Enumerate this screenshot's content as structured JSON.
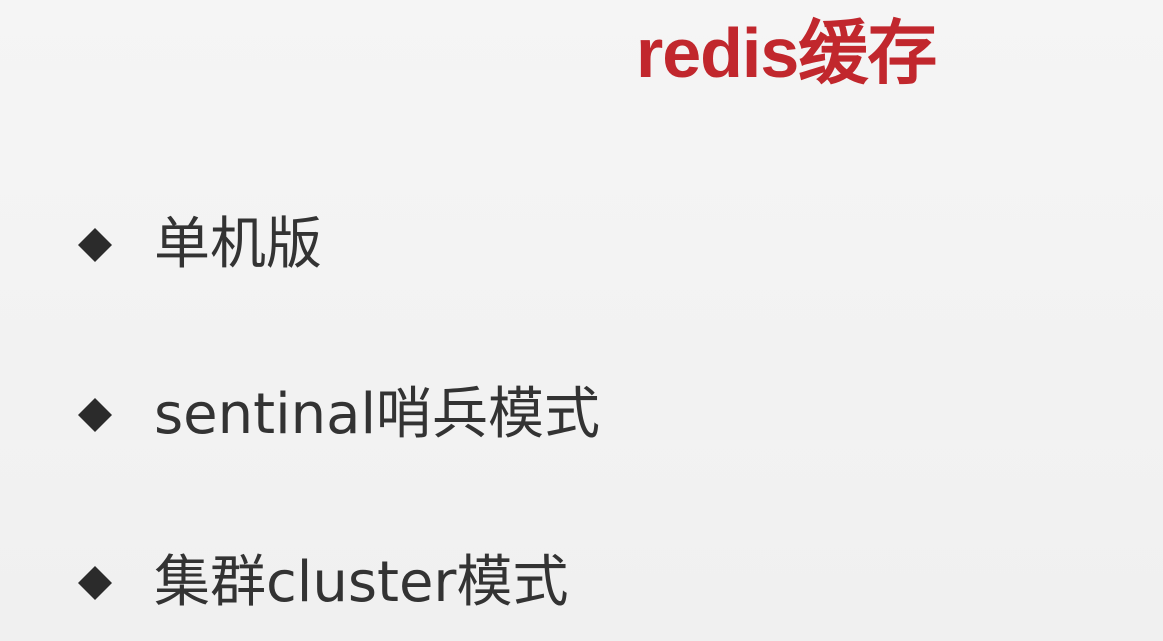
{
  "slide": {
    "title": "redis缓存",
    "title_color": "#c1272d",
    "bullets": [
      {
        "icon": "diamond-bullet-icon",
        "text": "单机版"
      },
      {
        "icon": "diamond-bullet-icon",
        "text": "sentinal哨兵模式"
      },
      {
        "icon": "diamond-bullet-icon",
        "text": "集群cluster模式"
      }
    ],
    "text_color": "#333333",
    "bullet_color": "#2b2b2b"
  }
}
